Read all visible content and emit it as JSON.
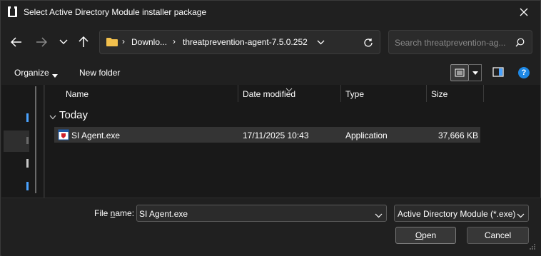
{
  "window": {
    "title": "Select Active Directory Module installer package"
  },
  "address_bar": {
    "crumbs": [
      "Downlo...",
      "threatprevention-agent-7.5.0.252"
    ]
  },
  "search": {
    "placeholder": "Search threatprevention-ag..."
  },
  "toolbar": {
    "organize_label": "Organize",
    "new_folder_label": "New folder"
  },
  "columns": {
    "name": "Name",
    "date_modified": "Date modified",
    "type": "Type",
    "size": "Size"
  },
  "group": {
    "label": "Today"
  },
  "files": [
    {
      "name": "SI Agent.exe",
      "date_modified": "17/11/2025 10:43",
      "type": "Application",
      "size": "37,666 KB"
    }
  ],
  "footer": {
    "file_name_label_prefix": "File ",
    "file_name_label_accel": "n",
    "file_name_label_suffix": "ame:",
    "file_name_value": "SI Agent.exe",
    "filter_value": "Active Directory Module (*.exe)",
    "open_accel": "O",
    "open_rest": "pen",
    "cancel_label": "Cancel"
  },
  "colors": {
    "accent": "#1e88e5",
    "folder": "#f2c04d",
    "background": "#202020",
    "pane": "#191919",
    "selected_row": "#343434"
  },
  "icons": [
    "app-icon",
    "close-icon",
    "back-arrow-icon",
    "forward-arrow-icon",
    "recent-dropdown-icon",
    "up-arrow-icon",
    "folder-icon",
    "chevron-right-icon",
    "refresh-icon",
    "search-icon",
    "view-details-icon",
    "preview-pane-icon",
    "help-icon",
    "exe-file-icon"
  ]
}
